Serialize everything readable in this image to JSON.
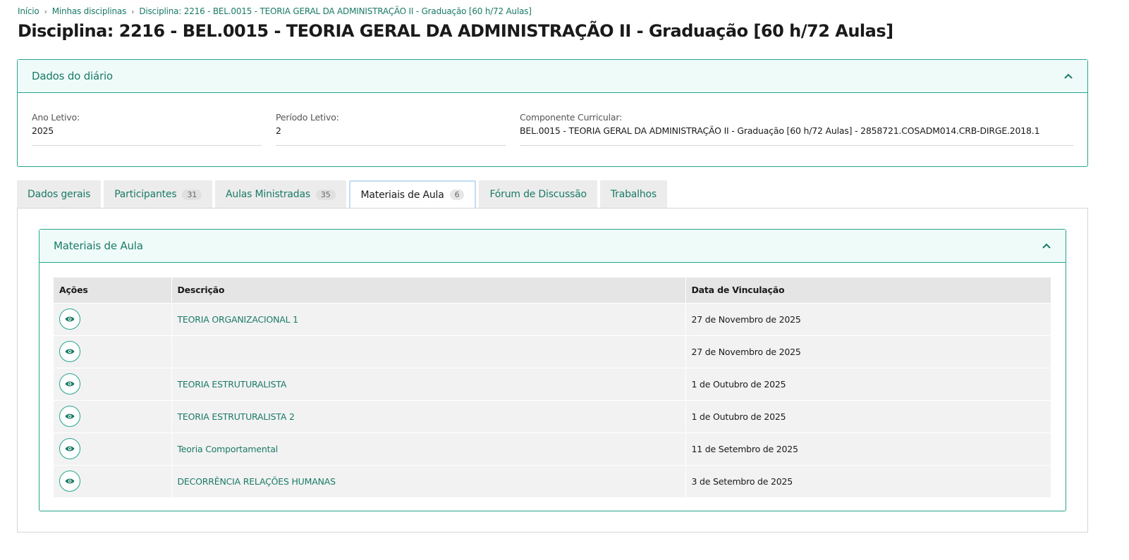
{
  "breadcrumb": [
    "Início",
    "Minhas disciplinas",
    "Disciplina: 2216 - BEL.0015 - TEORIA GERAL DA ADMINISTRAÇÃO II - Graduação [60 h/72 Aulas]"
  ],
  "title": "Disciplina: 2216 - BEL.0015 - TEORIA GERAL DA ADMINISTRAÇÃO II - Graduação [60 h/72 Aulas]",
  "diario": {
    "title": "Dados do diário",
    "ano_label": "Ano Letivo:",
    "ano_value": "2025",
    "periodo_label": "Período Letivo:",
    "periodo_value": "2",
    "componente_label": "Componente Curricular:",
    "componente_value": "BEL.0015 - TEORIA GERAL DA ADMINISTRAÇÃO II - Graduação [60 h/72 Aulas] - 2858721.COSADM014.CRB-DIRGE.2018.1"
  },
  "tabs": [
    {
      "label": "Dados gerais",
      "count": ""
    },
    {
      "label": "Participantes",
      "count": "31"
    },
    {
      "label": "Aulas Ministradas",
      "count": "35"
    },
    {
      "label": "Materiais de Aula",
      "count": "6"
    },
    {
      "label": "Fórum de Discussão",
      "count": ""
    },
    {
      "label": "Trabalhos",
      "count": ""
    }
  ],
  "materiais": {
    "title": "Materiais de Aula",
    "columns": [
      "Ações",
      "Descrição",
      "Data de Vinculação"
    ],
    "rows": [
      {
        "descricao": "TEORIA ORGANIZACIONAL 1",
        "data": "27 de Novembro de 2025"
      },
      {
        "descricao": "",
        "data": "27 de Novembro de 2025"
      },
      {
        "descricao": "TEORIA ESTRUTURALISTA",
        "data": "1 de Outubro de 2025"
      },
      {
        "descricao": "TEORIA ESTRUTURALISTA 2",
        "data": "1 de Outubro de 2025"
      },
      {
        "descricao": "Teoria Comportamental",
        "data": "11 de Setembro de 2025"
      },
      {
        "descricao": "DECORRÊNCIA RELAÇÕES HUMANAS",
        "data": "3 de Setembro de 2025"
      }
    ]
  },
  "colors": {
    "accent": "#1a7a66",
    "border": "#25a58b",
    "panel_head_bg": "#effbf9"
  }
}
